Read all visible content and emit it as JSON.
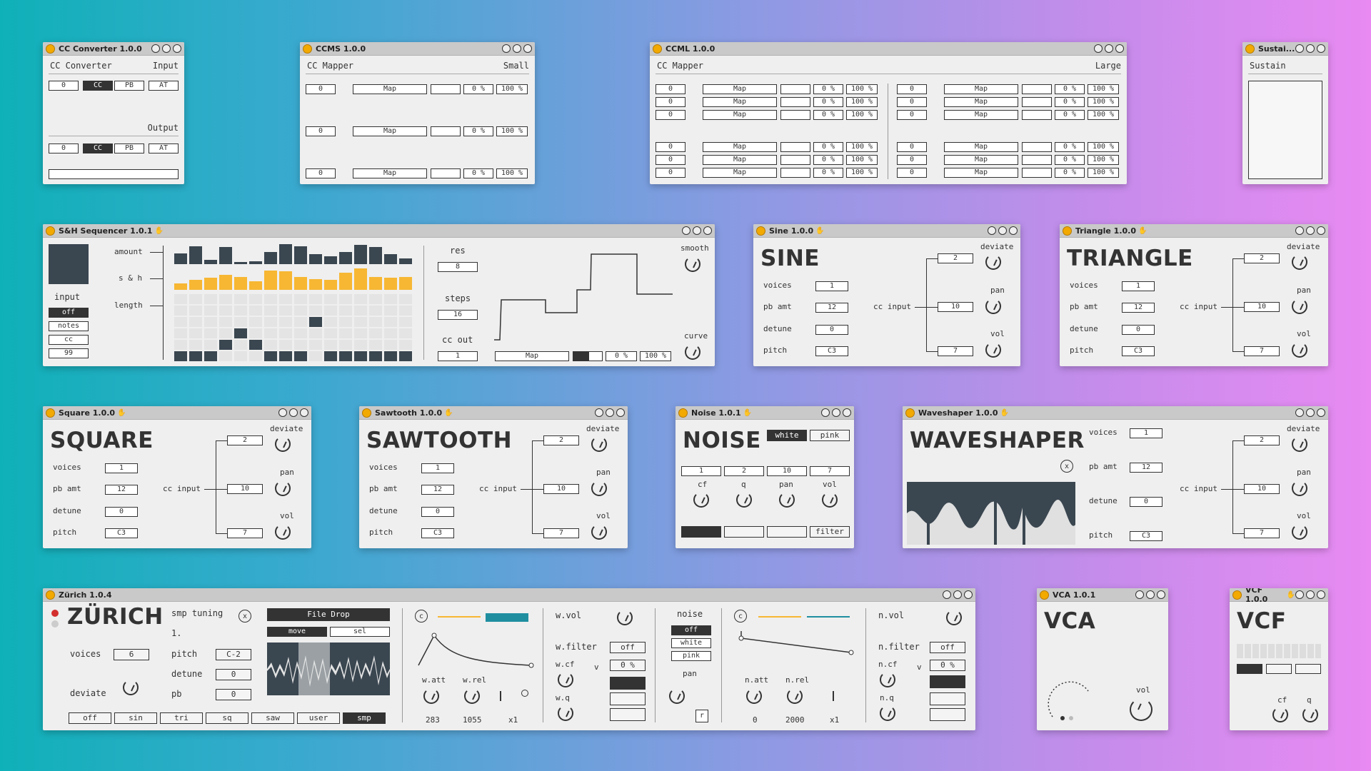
{
  "cc_converter": {
    "title": "CC Converter 1.0.0",
    "name": "CC Converter",
    "input_label": "Input",
    "output_label": "Output",
    "in_value": "0",
    "out_value": "0",
    "modes": [
      "CC",
      "PB",
      "AT"
    ],
    "selected": "CC"
  },
  "ccms": {
    "title": "CCMS 1.0.0",
    "name": "CC Mapper",
    "size": "Small",
    "row_value": "0",
    "map": "Map",
    "min": "0 %",
    "max": "100 %"
  },
  "ccml": {
    "title": "CCML 1.0.0",
    "name": "CC Mapper",
    "size": "Large",
    "row_value": "0",
    "map": "Map",
    "min": "0 %",
    "max": "100 %"
  },
  "sustain": {
    "title": "Sustai...",
    "name": "Sustain"
  },
  "sh": {
    "title": "S&H Sequencer 1.0.1",
    "amount": "amount",
    "sh": "s & h",
    "length": "length",
    "input": "input",
    "inputs": [
      "off",
      "notes",
      "cc",
      "99"
    ],
    "res": "res",
    "res_value": "8",
    "steps": "steps",
    "steps_value": "16",
    "cc_out": "cc out",
    "cc_out_value": "1",
    "map": "Map",
    "min": "0 %",
    "max": "100 %",
    "smooth": "smooth",
    "curve": "curve",
    "amount_values": [
      0.55,
      0.9,
      0.2,
      0.85,
      0.1,
      0.15,
      0.6,
      1,
      0.9,
      0.5,
      0.4,
      0.6,
      0.95,
      0.85,
      0.5,
      0.3
    ],
    "sh_values": [
      0.3,
      0.45,
      0.55,
      0.7,
      0.6,
      0.4,
      0.9,
      0.85,
      0.6,
      0.5,
      0.45,
      0.8,
      1,
      0.6,
      0.55,
      0.6
    ]
  },
  "sine": {
    "title": "Sine 1.0.0",
    "name": "SINE",
    "voices": "voices",
    "voices_v": "1",
    "pb": "pb amt",
    "pb_v": "12",
    "detune": "detune",
    "detune_v": "0",
    "pitch": "pitch",
    "pitch_v": "C3",
    "cc_input": "cc input",
    "deviate": "deviate",
    "deviate_v": "2",
    "pan": "pan",
    "pan_v": "10",
    "vol": "vol",
    "vol_v": "7"
  },
  "triangle": {
    "title": "Triangle 1.0.0",
    "name": "TRIANGLE",
    "voices": "voices",
    "voices_v": "1",
    "pb": "pb amt",
    "pb_v": "12",
    "detune": "detune",
    "detune_v": "0",
    "pitch": "pitch",
    "pitch_v": "C3",
    "cc_input": "cc input",
    "deviate": "deviate",
    "deviate_v": "2",
    "pan": "pan",
    "pan_v": "10",
    "vol": "vol",
    "vol_v": "7"
  },
  "square": {
    "title": "Square 1.0.0",
    "name": "SQUARE",
    "voices": "voices",
    "voices_v": "1",
    "pb": "pb amt",
    "pb_v": "12",
    "detune": "detune",
    "detune_v": "0",
    "pitch": "pitch",
    "pitch_v": "C3",
    "cc_input": "cc input",
    "deviate": "deviate",
    "deviate_v": "2",
    "pan": "pan",
    "pan_v": "10",
    "vol": "vol",
    "vol_v": "7"
  },
  "sawtooth": {
    "title": "Sawtooth 1.0.0",
    "name": "SAWTOOTH",
    "voices": "voices",
    "voices_v": "1",
    "pb": "pb amt",
    "pb_v": "12",
    "detune": "detune",
    "detune_v": "0",
    "pitch": "pitch",
    "pitch_v": "C3",
    "cc_input": "cc input",
    "deviate": "deviate",
    "deviate_v": "2",
    "pan": "pan",
    "pan_v": "10",
    "vol": "vol",
    "vol_v": "7"
  },
  "noise": {
    "title": "Noise 1.0.1",
    "name": "NOISE",
    "white": "white",
    "pink": "pink",
    "vals": [
      "1",
      "2",
      "10",
      "7"
    ],
    "cf": "cf",
    "q": "q",
    "pan": "pan",
    "vol": "vol",
    "filter": "filter"
  },
  "waveshaper": {
    "title": "Waveshaper 1.0.0",
    "name": "WAVESHAPER",
    "voices": "voices",
    "voices_v": "1",
    "pb": "pb amt",
    "pb_v": "12",
    "detune": "detune",
    "detune_v": "0",
    "pitch": "pitch",
    "pitch_v": "C3",
    "cc_input": "cc input",
    "deviate": "deviate",
    "deviate_v": "2",
    "pan": "pan",
    "pan_v": "10",
    "vol": "vol",
    "vol_v": "7",
    "x": "x"
  },
  "zurich": {
    "title": "Zürich 1.0.4",
    "name": "ZÜRICH",
    "smp_tuning": "smp tuning",
    "one": "1.",
    "x": "x",
    "voices": "voices",
    "voices_v": "6",
    "deviate": "deviate",
    "pitch": "pitch",
    "pitch_v": "C-2",
    "detune": "detune",
    "detune_v": "0",
    "pb": "pb",
    "pb_v": "0",
    "file_drop": "File Drop",
    "move": "move",
    "sel": "sel",
    "waves": [
      "off",
      "sin",
      "tri",
      "sq",
      "saw",
      "user",
      "smp"
    ],
    "wave_selected": "smp",
    "c": "c",
    "w_att": "w.att",
    "w_rel": "w.rel",
    "w_att_v": "283",
    "w_rel_v": "1055",
    "x1": "x1",
    "w_vol": "w.vol",
    "w_filter": "w.filter",
    "off": "off",
    "w_cf": "w.cf",
    "v": "v",
    "pct": "0 %",
    "w_q": "w.q",
    "noise": "noise",
    "noise_opts": [
      "off",
      "white",
      "pink"
    ],
    "pan": "pan",
    "r": "r",
    "n_att": "n.att",
    "n_rel": "n.rel",
    "n_att_v": "0",
    "n_rel_v": "2000",
    "n_vol": "n.vol",
    "n_filter": "n.filter",
    "n_cf": "n.cf",
    "n_q": "n.q"
  },
  "vca": {
    "title": "VCA 1.0.1",
    "name": "VCA",
    "vol": "vol"
  },
  "vcf": {
    "title": "VCF 1.0.0",
    "name": "VCF",
    "cf": "cf",
    "q": "q"
  },
  "colors": {
    "accent": "#f7b733",
    "teal": "#1f8fa0",
    "dark": "#3a4650"
  }
}
